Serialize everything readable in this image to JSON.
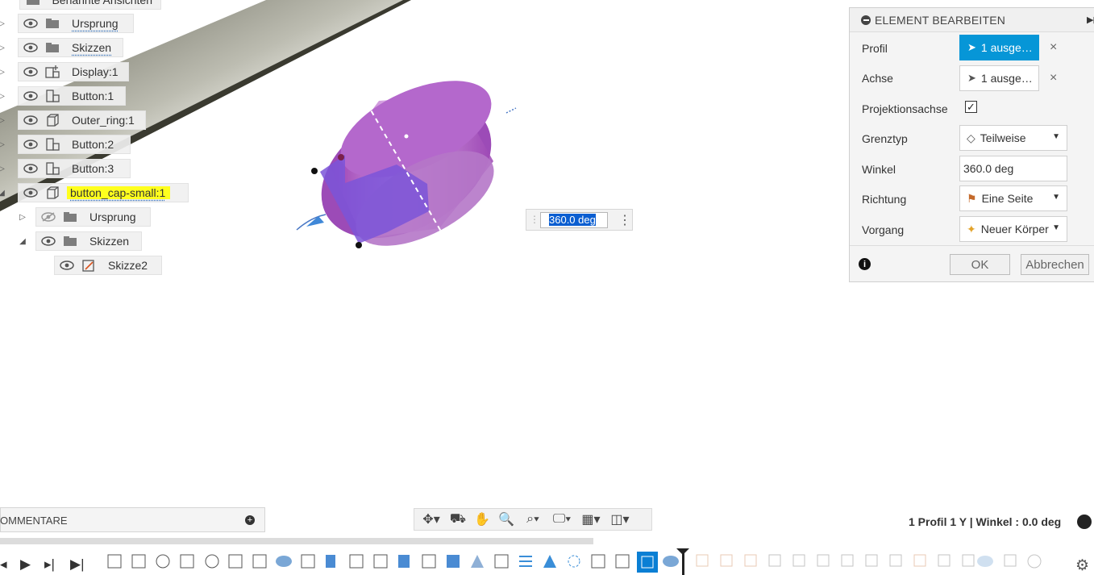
{
  "browser": {
    "named_views_label": "Benannte Ansichten",
    "items": [
      {
        "label": "Ursprung"
      },
      {
        "label": "Skizzen"
      },
      {
        "label": "Display:1"
      },
      {
        "label": "Button:1"
      },
      {
        "label": "Outer_ring:1"
      },
      {
        "label": "Button:2"
      },
      {
        "label": "Button:3"
      },
      {
        "label": "button_cap-small:1"
      },
      {
        "label": "Ursprung"
      },
      {
        "label": "Skizzen"
      },
      {
        "label": "Skizze2"
      }
    ]
  },
  "canvas": {
    "dimension_value": "360.0 deg"
  },
  "panel": {
    "title": "ELEMENT BEARBEITEN",
    "rows": {
      "profil_label": "Profil",
      "profil_value": "1 ausge…",
      "achse_label": "Achse",
      "achse_value": "1 ausge…",
      "projektion_label": "Projektionsachse",
      "projektion_checked": true,
      "grenztyp_label": "Grenztyp",
      "grenztyp_value": "Teilweise",
      "winkel_label": "Winkel",
      "winkel_value": "360.0 deg",
      "richtung_label": "Richtung",
      "richtung_value": "Eine Seite",
      "vorgang_label": "Vorgang",
      "vorgang_value": "Neuer Körper"
    },
    "ok_label": "OK",
    "cancel_label": "Abbrechen"
  },
  "bottom": {
    "comments_label": "OMMENTARE",
    "status_text": "1 Profil 1 Y | Winkel : 0.0 deg"
  },
  "colors": {
    "accent": "#0696d7",
    "highlight": "#ffff1e",
    "body_purple": "#a24ab8"
  }
}
